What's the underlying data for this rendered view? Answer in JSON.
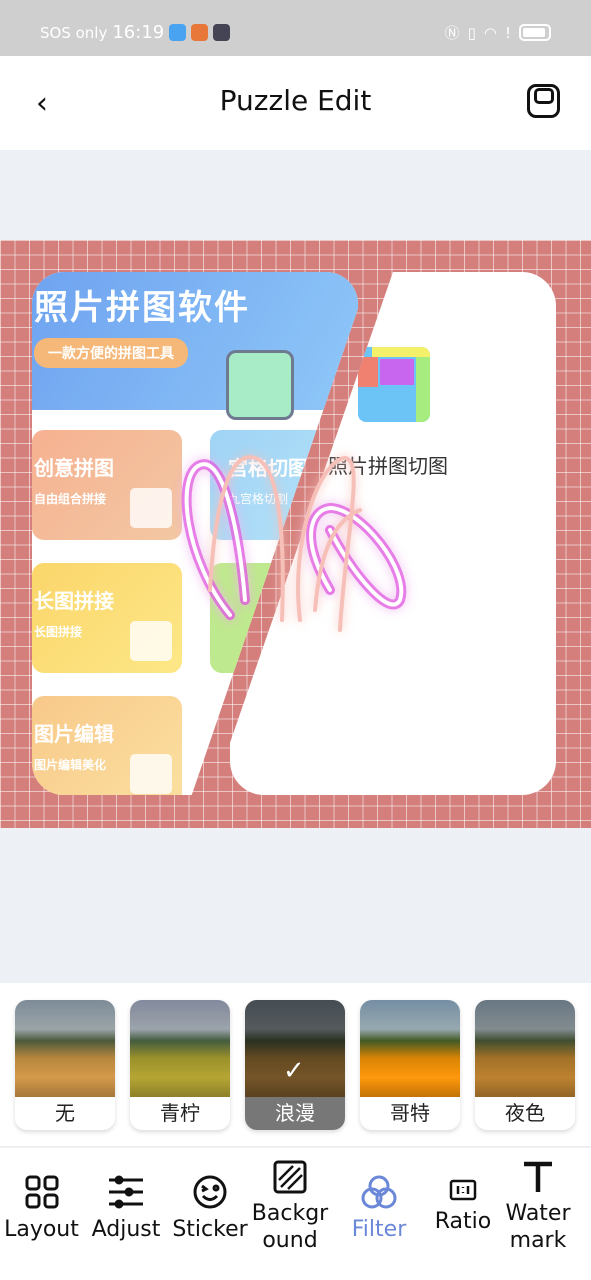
{
  "status": {
    "carrier": "SOS only",
    "time": "16:19"
  },
  "header": {
    "title": "Puzzle Edit",
    "back": "‹"
  },
  "collage": {
    "left": {
      "hero_title": "照片拼图软件",
      "hero_pill": "一款方便的拼图工具",
      "cards": [
        {
          "title": "创意拼图",
          "sub": "自由组合拼接"
        },
        {
          "title": "长图拼接",
          "sub": "长图拼接"
        },
        {
          "title": "图片编辑",
          "sub": "图片编辑美化"
        }
      ],
      "grid_card": {
        "title": "宫格切图",
        "sub": "九宫格切割"
      }
    },
    "right": {
      "app_name": "照片拼图切图"
    },
    "background_color": "#d47f7c"
  },
  "filters": {
    "items": [
      {
        "label": "无"
      },
      {
        "label": "青柠"
      },
      {
        "label": "浪漫",
        "selected": true
      },
      {
        "label": "哥特"
      },
      {
        "label": "夜色"
      }
    ],
    "check": "✓"
  },
  "toolbar": {
    "items": [
      {
        "label": "Layout",
        "icon": "layout-icon"
      },
      {
        "label": "Adjust",
        "icon": "sliders-icon"
      },
      {
        "label": "Sticker",
        "icon": "smiley-icon"
      },
      {
        "label": "Backgr\nound",
        "icon": "background-icon"
      },
      {
        "label": "Filter",
        "icon": "filter-icon",
        "active": true
      },
      {
        "label": "Ratio",
        "icon": "ratio-icon"
      },
      {
        "label": "Water\nmark",
        "icon": "text-icon"
      }
    ],
    "active_color": "#6b88d8"
  }
}
